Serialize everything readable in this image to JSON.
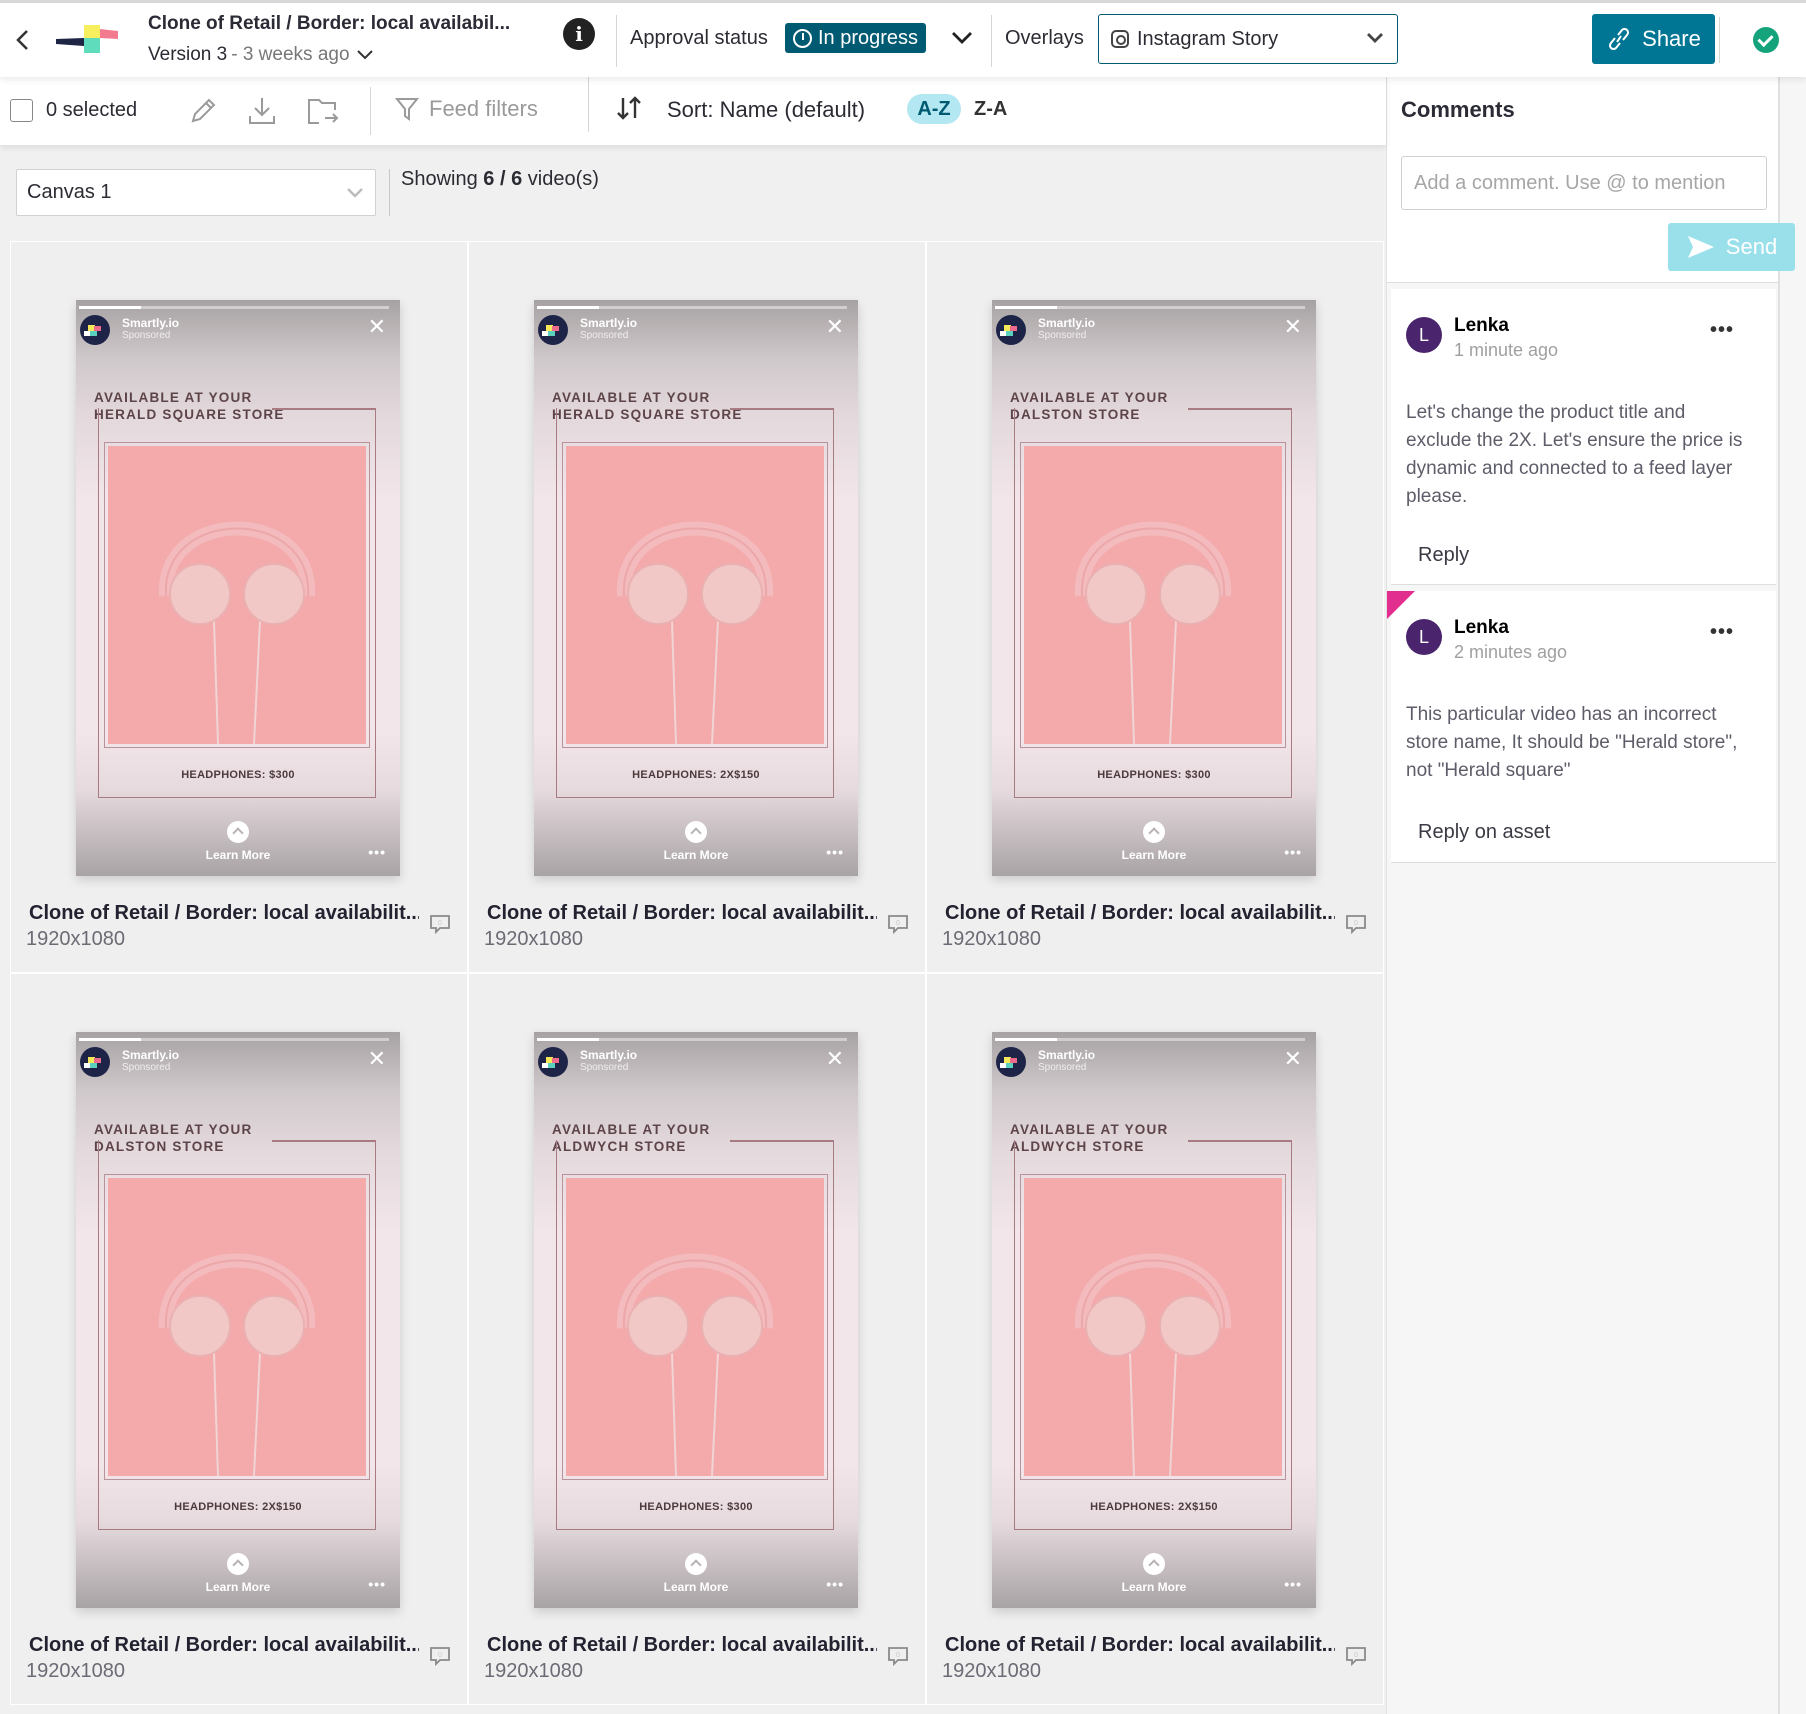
{
  "header": {
    "title": "Clone of Retail / Border: local availabil...",
    "version": "Version 3",
    "version_ago": "- 3 weeks ago",
    "approval_label": "Approval status",
    "approval_status": "In progress",
    "overlays_label": "Overlays",
    "overlay_selected": "Instagram Story",
    "share_label": "Share"
  },
  "toolbar": {
    "selected_count": "0 selected",
    "feed_filters": "Feed filters",
    "sort_label": "Sort: Name (default)",
    "sort_az": "A-Z",
    "sort_za": "Z-A"
  },
  "canvas": {
    "selected": "Canvas 1",
    "showing_prefix": "Showing ",
    "showing_count": "6 / 6",
    "showing_suffix": " video(s)"
  },
  "story_common": {
    "brand": "Smartly.io",
    "sponsored": "Sponsored",
    "available_line": "AVAILABLE AT YOUR",
    "cta": "Learn More",
    "progress": 0.2
  },
  "cards": [
    {
      "store": "HERALD SQUARE STORE",
      "price": "HEADPHONES: $300",
      "title": "Clone of Retail / Border: local availabilit...",
      "dims": "1920x1080",
      "comments": "0"
    },
    {
      "store": "HERALD SQUARE STORE",
      "price": "HEADPHONES: 2X$150",
      "title": "Clone of Retail / Border: local availabilit...",
      "dims": "1920x1080",
      "comments": "0"
    },
    {
      "store": "DALSTON STORE",
      "price": "HEADPHONES: $300",
      "title": "Clone of Retail / Border: local availabilit...",
      "dims": "1920x1080",
      "comments": "0"
    },
    {
      "store": "DALSTON STORE",
      "price": "HEADPHONES: 2X$150",
      "title": "Clone of Retail / Border: local availabilit...",
      "dims": "1920x1080",
      "comments": "0"
    },
    {
      "store": "ALDWYCH STORE",
      "price": "HEADPHONES: $300",
      "title": "Clone of Retail / Border: local availabilit...",
      "dims": "1920x1080",
      "comments": "0"
    },
    {
      "store": "ALDWYCH STORE",
      "price": "HEADPHONES: 2X$150",
      "title": "Clone of Retail / Border: local availabilit...",
      "dims": "1920x1080",
      "comments": "0"
    }
  ],
  "comments": {
    "title": "Comments",
    "input_placeholder": "Add a comment. Use @ to mention",
    "send_label": "Send",
    "items": [
      {
        "initial": "L",
        "author": "Lenka",
        "time": "1 minute ago",
        "body": "Let's change the product title and exclude the 2X. Let's ensure the price is dynamic and connected to a feed layer please.",
        "reply_label": "Reply"
      },
      {
        "initial": "L",
        "author": "Lenka",
        "time": "2 minutes ago",
        "body": "This particular video has an incorrect store name, It should be \"Herald store\", not \"Herald square\"",
        "reply_label": "Reply on asset"
      }
    ]
  },
  "colors": {
    "accent": "#007694",
    "status_bg": "#005b72",
    "approved": "#14a37a",
    "avatar": "#4a256d",
    "flag": "#e22f8f"
  }
}
